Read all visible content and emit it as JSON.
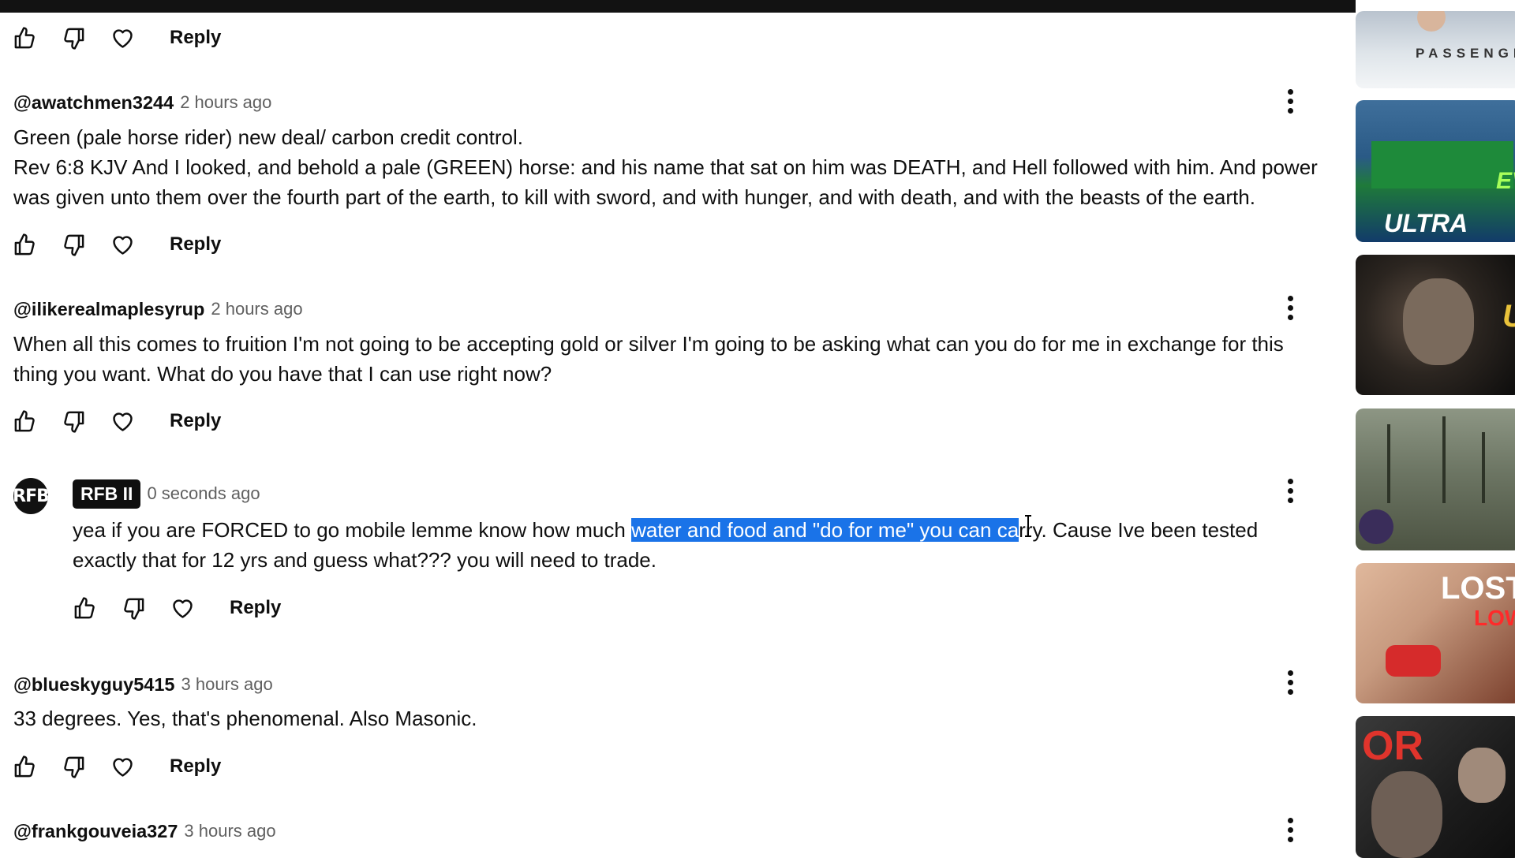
{
  "actions": {
    "reply_label": "Reply"
  },
  "comments": [
    {
      "author": "@awatchmen3244",
      "time": "2 hours ago",
      "text": "Green (pale horse rider) new deal/ carbon credit control.\nRev 6:8 KJV And I looked, and behold a pale (GREEN) horse: and his name that sat on him was DEATH, and Hell followed with him. And power\nwas given unto them over the fourth part of the earth, to kill with sword, and with hunger, and with death, and with the beasts of the earth."
    },
    {
      "author": "@ilikerealmaplesyrup",
      "time": "2 hours ago",
      "text": "When all this comes to fruition I'm not going to be accepting gold or silver I'm going to be asking what can you do for me in exchange for this\nthing you want. What do you have that I can use right now?"
    },
    {
      "author": "RFB II",
      "avatar_text": "RFB",
      "time": "0 seconds ago",
      "text_before": "yea if you are FORCED to go mobile lemme know how much ",
      "text_selected": "water and food and \"do for me\" you can ca",
      "text_after": "rry. Cause Ive been tested\nexactly that for 12 yrs and guess what??? you will need to trade."
    },
    {
      "author": "@blueskyguy5415",
      "time": "3 hours ago",
      "text": "33 degrees.  Yes, that's phenomenal.  Also Masonic."
    },
    {
      "author": "@frankgouveia327",
      "time": "3 hours ago"
    }
  ],
  "sidebar": {
    "thumbnails": [
      {
        "overlay_text": "PASSENGE",
        "colors": [
          "#a9b7c6",
          "#f1f3f5"
        ]
      },
      {
        "overlay_text": "ULTRA LARGE",
        "overlay_text_2": "EV",
        "colors": [
          "#2a5a86",
          "#1d6b2f"
        ]
      },
      {
        "overlay_text": "U",
        "colors": [
          "#2b2520",
          "#0b0b0b"
        ]
      },
      {
        "overlay_text": "",
        "colors": [
          "#6c7563",
          "#3e4536"
        ]
      },
      {
        "overlay_text": "LOST",
        "overlay_text_2": "LOW",
        "colors": [
          "#c79a7f",
          "#7a3f2c"
        ]
      },
      {
        "overlay_text": "OR",
        "colors": [
          "#2b2b2b",
          "#0e0e0e"
        ]
      }
    ]
  },
  "colors": {
    "selection": "#1a73e8",
    "text": "#0f0f0f",
    "meta": "#606060",
    "topbar": "#121212"
  }
}
